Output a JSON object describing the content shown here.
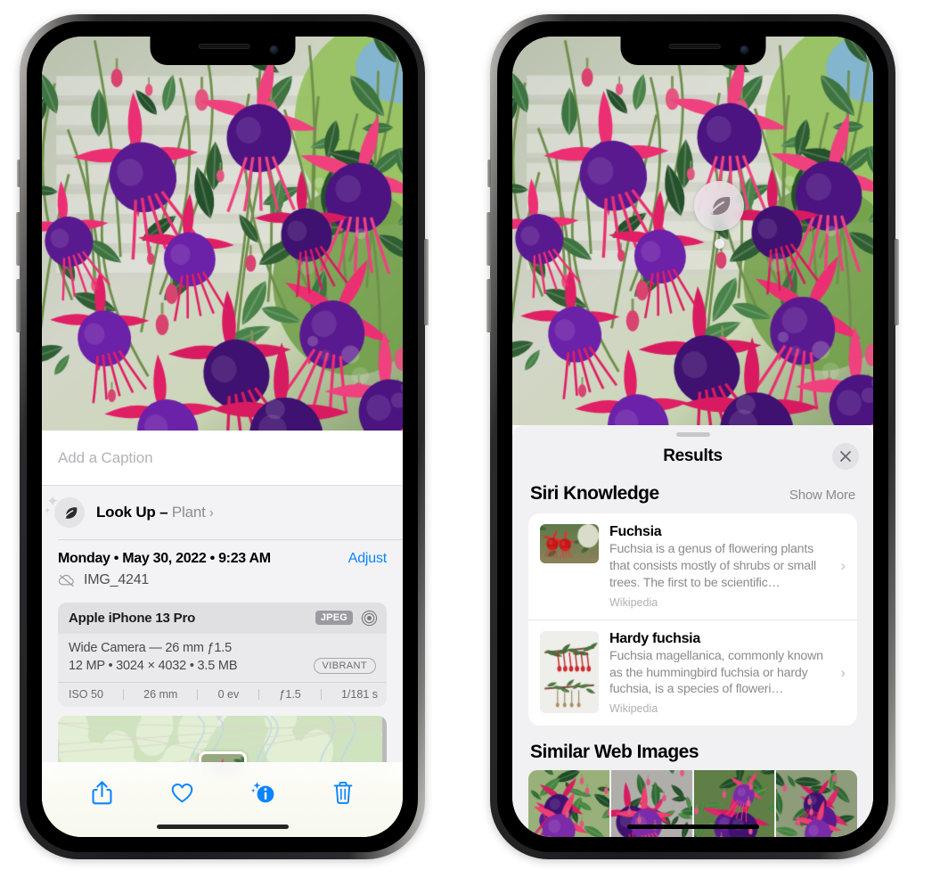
{
  "left_phone": {
    "photo": {
      "alt": "Close-up of pink and purple fuchsia flowers hanging from a basket on a porch"
    },
    "caption_field": {
      "value": "",
      "placeholder": "Add a Caption"
    },
    "lookup_row": {
      "icon": "leaf-icon",
      "sparkle_icon": "sparkle-icon",
      "label": "Look Up",
      "dash": " – ",
      "subject": "Plant",
      "chevron": "›"
    },
    "metadata": {
      "date_line": "Monday • May 30, 2022 • 9:23 AM",
      "adjust_label": "Adjust",
      "cloud_icon": "cloud-slash-icon",
      "filename": "IMG_4241"
    },
    "camera_card": {
      "model": "Apple iPhone 13 Pro",
      "format_badge": "JPEG",
      "lens_icon": "lens-icon",
      "line1": "Wide Camera — 26 mm ƒ1.5",
      "line2": "12 MP • 3024 × 4032 • 3.5 MB",
      "profile_badge": "VIBRANT",
      "exif": [
        "ISO 50",
        "26 mm",
        "0 ev",
        "ƒ1.5",
        "1/181 s"
      ]
    },
    "map": {
      "alt": "Map thumbnail with green parkland and a photo location pin"
    },
    "toolbar": {
      "items": [
        {
          "name": "share-icon",
          "label": "Share"
        },
        {
          "name": "heart-icon",
          "label": "Favorite"
        },
        {
          "name": "info-sparkle-icon",
          "label": "Info"
        },
        {
          "name": "trash-icon",
          "label": "Delete"
        }
      ],
      "accent_color": "#0a84ff"
    }
  },
  "right_phone": {
    "photo": {
      "alt": "Close-up of pink and purple fuchsia flowers hanging from a basket on a porch"
    },
    "visual_lookup_badge": {
      "icon": "leaf-icon",
      "label": "Plant detected"
    },
    "sheet": {
      "title": "Results",
      "close_icon": "close-icon",
      "sections": [
        {
          "title": "Siri Knowledge",
          "action_label": "Show More",
          "cards": [
            {
              "title": "Fuchsia",
              "description": "Fuchsia is a genus of flowering plants that consists mostly of shrubs or small trees. The first to be scientific…",
              "source": "Wikipedia",
              "thumb_alt": "Red fuchsia flowers",
              "chevron": "›"
            },
            {
              "title": "Hardy fuchsia",
              "description": "Fuchsia magellanica, commonly known as the hummingbird fuchsia or hardy fuchsia, is a species of floweri…",
              "source": "Wikipedia",
              "thumb_alt": "Herbarium specimen of hardy fuchsia",
              "chevron": "›"
            }
          ]
        },
        {
          "title": "Similar Web Images",
          "images": [
            {
              "alt": "Pink and magenta fuchsia with buds and leaves"
            },
            {
              "alt": "Close-up of red and magenta fuchsia blossoms"
            },
            {
              "alt": "Fuchsia shrub with many buds"
            },
            {
              "alt": "Purple and red double fuchsia flowers"
            }
          ]
        }
      ]
    }
  }
}
